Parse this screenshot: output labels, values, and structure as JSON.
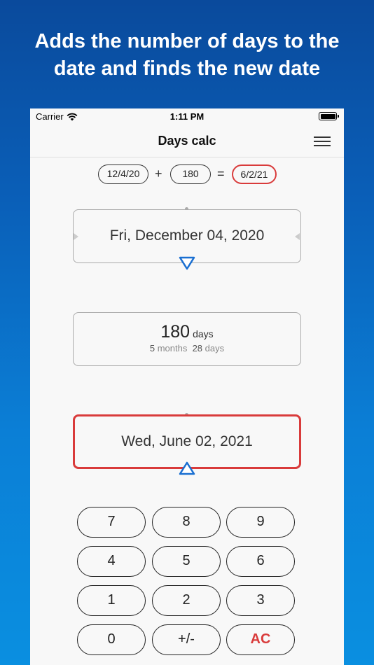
{
  "headline": {
    "line1": "Adds the number of days to the",
    "line2": "date and finds the new date"
  },
  "status": {
    "carrier": "Carrier",
    "time": "1:11 PM"
  },
  "nav": {
    "title": "Days calc",
    "menu_icon": "hamburger-menu-icon"
  },
  "summary": {
    "start": "12/4/20",
    "plus": "+",
    "days": "180",
    "equals": "=",
    "result": "6/2/21"
  },
  "start_date": "Fri, December 04, 2020",
  "days_card": {
    "value": "180",
    "unit": "days",
    "months_value": "5",
    "months_label": "months",
    "days_value": "28",
    "days_label": "days"
  },
  "result_date": "Wed, June 02, 2021",
  "keypad": {
    "k7": "7",
    "k8": "8",
    "k9": "9",
    "k4": "4",
    "k5": "5",
    "k6": "6",
    "k1": "1",
    "k2": "2",
    "k3": "3",
    "k0": "0",
    "sign": "+/-",
    "ac": "AC"
  },
  "colors": {
    "accent_red": "#d93b3b",
    "accent_blue": "#1a6fd1"
  }
}
